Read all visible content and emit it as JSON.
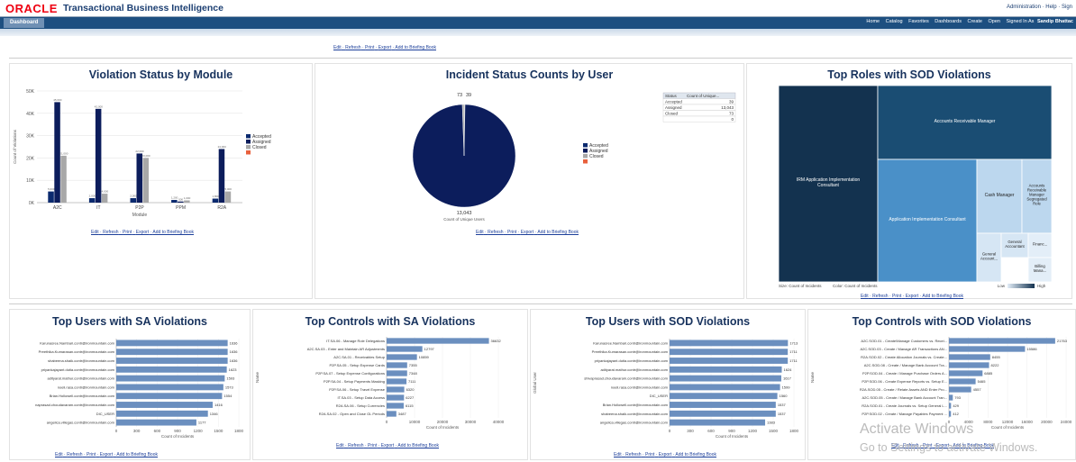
{
  "header": {
    "logo": "ORACLE",
    "app_title": "Transactional Business Intelligence",
    "top_links": [
      "Administration",
      "Help",
      "Sign"
    ]
  },
  "nav": {
    "tab": "Dashboard",
    "links": [
      "Home",
      "Catalog",
      "Favorites",
      "Dashboards",
      "Create",
      "Open",
      "Signed In As"
    ],
    "user": "Sandip Bhattac"
  },
  "links": {
    "edit": "Edit",
    "refresh": "Refresh",
    "print": "Print",
    "export": "Export",
    "briefing": "Add to Briefing Book"
  },
  "colors": {
    "accepted": "#0b2a6f",
    "assigned": "#0c1d5c",
    "closed": "#a8a8a8",
    "other": "#e8603c",
    "bar": "#6b8fbf",
    "title": "#17325d"
  },
  "violation_status": {
    "title": "Violation Status by Module",
    "ylabel": "Count of Violations",
    "xlabel": "Module",
    "legend": [
      "Accepted",
      "Assigned",
      "Closed",
      ""
    ],
    "chart_data": {
      "type": "bar",
      "categories": [
        "A2C",
        "IT",
        "P2P",
        "PPM",
        "R2A"
      ],
      "series": [
        {
          "name": "Accepted",
          "values": [
            5000,
            2000,
            2000,
            1200,
            1800
          ]
        },
        {
          "name": "Assigned",
          "values": [
            45000,
            42000,
            22000,
            500,
            24000
          ]
        },
        {
          "name": "Closed",
          "values": [
            21000,
            4000,
            20000,
            1000,
            5000
          ]
        }
      ],
      "ylim": [
        0,
        50000
      ],
      "yticks": [
        "0K",
        "10K",
        "20K",
        "30K",
        "40K",
        "50K"
      ]
    }
  },
  "incident_status": {
    "title": "Incident Status Counts by User",
    "top_labels": [
      "73",
      "39"
    ],
    "bottom_label": "13,043",
    "xlabel": "Count of Unique Users",
    "legend": [
      "Accepted",
      "Assigned",
      "Closed",
      ""
    ],
    "table_header": [
      "Status",
      "Count of Unique..."
    ],
    "table_rows": [
      [
        "Accepted",
        "39"
      ],
      [
        "Assigned",
        "13,043"
      ],
      [
        "Closed",
        "73"
      ],
      [
        "",
        "0"
      ]
    ],
    "chart_data": {
      "type": "pie",
      "categories": [
        "Accepted",
        "Assigned",
        "Closed"
      ],
      "values": [
        39,
        13043,
        73
      ]
    }
  },
  "top_roles": {
    "title": "Top Roles with SOD Violations",
    "cells": [
      {
        "label": "IRM Application Implementation Consultant"
      },
      {
        "label": "Accounts Receivable Manager"
      },
      {
        "label": "Application Implementation Consultant"
      },
      {
        "label": "Cash Manager"
      },
      {
        "label": "Accounts Receivable Manager Segregated Role"
      },
      {
        "label": "General Account..."
      },
      {
        "label": "General Accountant"
      },
      {
        "label": "Financ..."
      },
      {
        "label": "Billing Mana..."
      }
    ],
    "size_label": "Size: Count of Incidents",
    "color_label": "Color: Count of Incidents",
    "low": "Low",
    "high": "High"
  },
  "sa_users": {
    "title": "Top Users with SA Violations",
    "xlabel": "Count of Incidents",
    "chart_data": {
      "type": "bar",
      "categories": [
        "Karunasree.Nambari.contr@ironmountain.com",
        "Preethika.Kumarasan.contr@ironmountain.com",
        "shabeena.shaik.contr@ironmountain.com",
        "priyankajayant.dutia.contr@ironmountain.com",
        "adityarat.mathur.contr@ironmountain.com",
        "noeli.rasa.contr@ironmountain.com",
        "Brian.Hollowell.contr@ironmountain.com",
        "naprasad.choudavaram.contr@ironmountain.com",
        "DIC_USER",
        "angelica.villegas.contr@ironmountain.com"
      ],
      "values": [
        1636,
        1636,
        1636,
        1623,
        1593,
        1573,
        1554,
        1416,
        1346,
        1177
      ],
      "xticks": [
        "0",
        "300",
        "600",
        "900",
        "1200",
        "1500",
        "1800"
      ],
      "xlim": [
        0,
        1800
      ]
    }
  },
  "sa_controls": {
    "title": "Top Controls with SA Violations",
    "ylabel": "Name",
    "xlabel": "Count of Incidents",
    "chart_data": {
      "type": "bar",
      "categories": [
        "IT.SA.06 - Manage Role Delegations",
        "A2C.SA.03 - Enter and Maintain AR Adjustments",
        "A2C.SA.01 - Receivables Setup",
        "P2P.SA.05 - Setup Expense Cards",
        "P2P.SA.07 - Setup Expense Configurations",
        "P2P.SA.04 - Setup Payments Masking",
        "P2P.SA.06 - Setup Travel Expense",
        "IT.SA.03 - Setup Data Access",
        "R2A.SA.06 - Setup Currencies",
        "R2A.SA.02 - Open and Close GL Periods"
      ],
      "values": [
        36632,
        12797,
        10859,
        7355,
        7348,
        7111,
        6320,
        6227,
        6115,
        3487
      ],
      "xticks": [
        "0",
        "10000",
        "20000",
        "30000",
        "40000"
      ],
      "xlim": [
        0,
        40000
      ]
    }
  },
  "sod_users": {
    "title": "Top Users with SOD Violations",
    "ylabel": "Global User",
    "xlabel": "Count of Incidents",
    "chart_data": {
      "type": "bar",
      "categories": [
        "Karunasree.Nambari.contr@ironmountain.com",
        "Preethika.Kumarasan.contr@ironmountain.com",
        "priyankajayant.dutia.contr@ironmountain.com",
        "adityarat.mathur.contr@ironmountain.com",
        "shivaprasad.choudavaram.contr@ironmountain.com",
        "noeli.rasa.contr@ironmountain.com",
        "DIC_USER",
        "Brian.Hollowell.contr@ironmountain.com",
        "shabeena.shaik.contr@ironmountain.com",
        "angelica.villegas.contr@ironmountain.com"
      ],
      "values": [
        1713,
        1711,
        1711,
        1624,
        1617,
        1599,
        1560,
        1537,
        1537,
        1383
      ],
      "xticks": [
        "0",
        "300",
        "600",
        "900",
        "1200",
        "1500",
        "1800"
      ],
      "xlim": [
        0,
        1800
      ]
    }
  },
  "sod_controls": {
    "title": "Top Controls with SOD Violations",
    "ylabel": "Name",
    "xlabel": "Count of Incidents",
    "chart_data": {
      "type": "bar",
      "categories": [
        "A2C.SOD.01 - Create\\Manage Customers vs. Recei...",
        "A2C.SOD.03 - Create / Manage AR Transactions AN...",
        "R2A.SOD.02 - Create Allocation Journals vs. Create...",
        "A2C.SOD.08 - Create / Manage Bank Account Tra...",
        "P2P.SOD.04 - Create / Manage Purchase Orders A...",
        "P2P.SOD.06 - Create Expense Reports vs. Setup E...",
        "R2A.SOD.05 - Create / Relate Assets AND Enter Pro...",
        "A2C.SOD.05 - Create / Manage Bank Account Tran...",
        "R2A.SOD.01 - Create Journals vs. Setup General L...",
        "P2P.SOD.02 - Create / Manage Payables Payment ..."
      ],
      "values": [
        21763,
        15586,
        8455,
        8222,
        6885,
        5465,
        4557,
        793,
        429,
        412
      ],
      "xticks": [
        "0",
        "4000",
        "8000",
        "12000",
        "16000",
        "20000",
        "24000"
      ],
      "xlim": [
        0,
        24000
      ]
    }
  },
  "watermark": {
    "line1": "Activate Windows",
    "line2": "Go to Settings to activate Windows."
  }
}
